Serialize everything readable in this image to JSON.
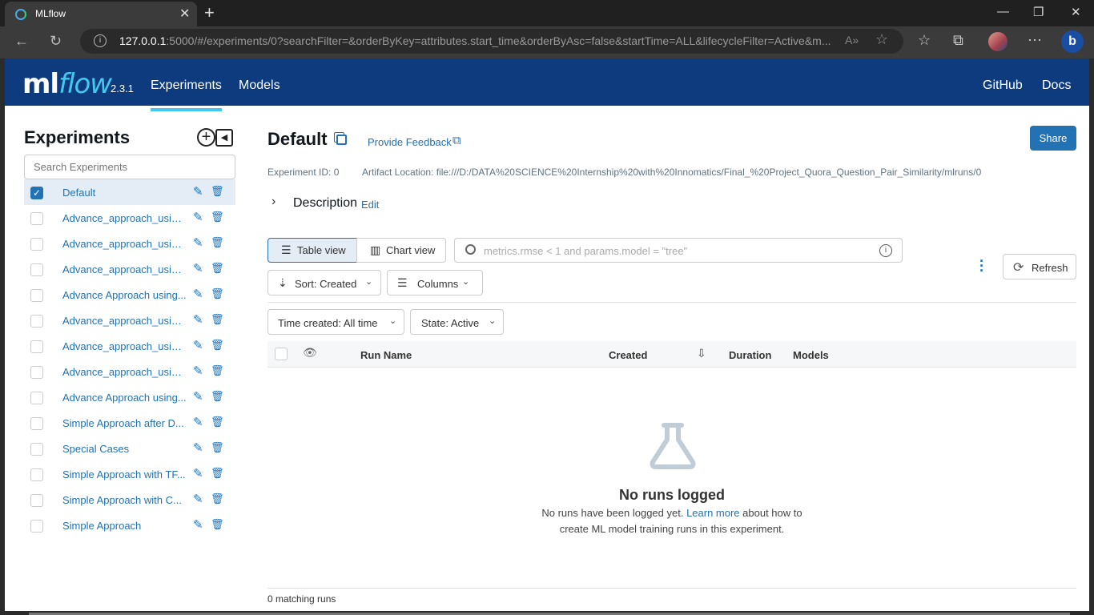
{
  "browser": {
    "tab_title": "MLflow",
    "url_host": "127.0.0.1",
    "url_rest": ":5000/#/experiments/0?searchFilter=&orderByKey=attributes.start_time&orderByAsc=false&startTime=ALL&lifecycleFilter=Active&m..."
  },
  "header": {
    "logo_ml": "ml",
    "logo_flow": "flow",
    "version": "2.3.1",
    "nav": [
      "Experiments",
      "Models"
    ],
    "right_nav": [
      "GitHub",
      "Docs"
    ]
  },
  "sidebar": {
    "title": "Experiments",
    "search_placeholder": "Search Experiments",
    "experiments": [
      {
        "name": "Default",
        "selected": true
      },
      {
        "name": "Advance_approach_using..."
      },
      {
        "name": "Advance_approach_using..."
      },
      {
        "name": "Advance_approach_using..."
      },
      {
        "name": "Advance Approach using..."
      },
      {
        "name": "Advance_approach_using..."
      },
      {
        "name": "Advance_approach_using..."
      },
      {
        "name": "Advance_approach_using..."
      },
      {
        "name": "Advance Approach using..."
      },
      {
        "name": "Simple Approach after D..."
      },
      {
        "name": "Special Cases"
      },
      {
        "name": "Simple Approach with TF..."
      },
      {
        "name": "Simple Approach with C..."
      },
      {
        "name": "Simple Approach"
      }
    ]
  },
  "main": {
    "title": "Default",
    "feedback_label": "Provide Feedback",
    "share_label": "Share",
    "experiment_id": "Experiment ID: 0",
    "artifact_location": "Artifact Location: file:///D:/DATA%20SCIENCE%20Internship%20with%20Innomatics/Final_%20Project_Quora_Question_Pair_Similarity/mlruns/0",
    "description_label": "Description",
    "description_edit": "Edit",
    "table_view": "Table view",
    "chart_view": "Chart view",
    "search_placeholder": "metrics.rmse < 1 and params.model = \"tree\"",
    "refresh": "Refresh",
    "sort_label": "Sort: Created",
    "columns_label": "Columns",
    "time_filter": "Time created: All time",
    "state_filter": "State: Active",
    "columns": [
      "Run Name",
      "Created",
      "Duration",
      "Models"
    ],
    "empty_title": "No runs logged",
    "empty_text_before": "No runs have been logged yet. ",
    "empty_link": "Learn more",
    "empty_text_after": " about how to",
    "empty_text_line2": "create ML model training runs in this experiment.",
    "matching": "0 matching runs"
  }
}
